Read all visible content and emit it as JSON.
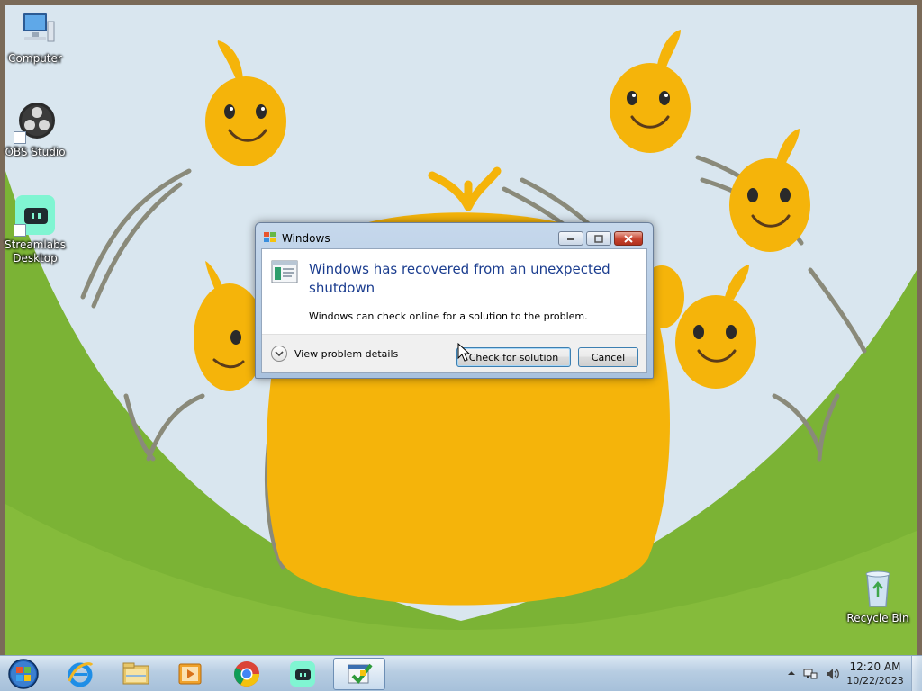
{
  "desktop": {
    "icons": [
      {
        "label": "Computer",
        "icon": "computer-icon"
      },
      {
        "label": "OBS Studio",
        "icon": "obs-studio-icon"
      },
      {
        "label": "Streamlabs Desktop",
        "icon": "streamlabs-icon"
      },
      {
        "label": "Recycle Bin",
        "icon": "recycle-bin-icon"
      }
    ]
  },
  "dialog": {
    "title": "Windows",
    "heading": "Windows has recovered from an unexpected shutdown",
    "message": "Windows can check online for a solution to the problem.",
    "details_label": "View problem details",
    "check_button": "Check for solution",
    "cancel_button": "Cancel"
  },
  "taskbar": {
    "items": [
      {
        "icon": "start-orb-icon"
      },
      {
        "icon": "internet-explorer-icon"
      },
      {
        "icon": "file-explorer-icon"
      },
      {
        "icon": "media-player-icon"
      },
      {
        "icon": "chrome-icon"
      },
      {
        "icon": "streamlabs-icon"
      },
      {
        "icon": "problem-reports-icon",
        "active": true
      }
    ],
    "clock": {
      "time": "12:20 AM",
      "date": "10/22/2023"
    }
  },
  "colors": {
    "wallpaper_sky": "#d9e6ef",
    "wallpaper_hill": "#7bb335",
    "character": "#f5b40a",
    "heading_blue": "#1b3d8f",
    "taskbar": "#b7cde2"
  }
}
